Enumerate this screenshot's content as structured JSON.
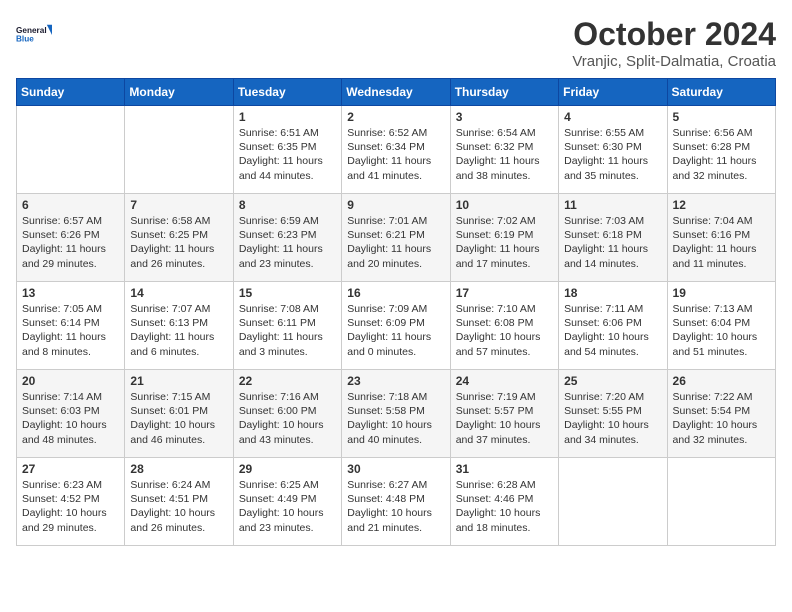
{
  "header": {
    "logo_line1": "General",
    "logo_line2": "Blue",
    "month": "October 2024",
    "location": "Vranjic, Split-Dalmatia, Croatia"
  },
  "days_of_week": [
    "Sunday",
    "Monday",
    "Tuesday",
    "Wednesday",
    "Thursday",
    "Friday",
    "Saturday"
  ],
  "weeks": [
    [
      {
        "day": "",
        "content": ""
      },
      {
        "day": "",
        "content": ""
      },
      {
        "day": "1",
        "content": "Sunrise: 6:51 AM\nSunset: 6:35 PM\nDaylight: 11 hours\nand 44 minutes."
      },
      {
        "day": "2",
        "content": "Sunrise: 6:52 AM\nSunset: 6:34 PM\nDaylight: 11 hours\nand 41 minutes."
      },
      {
        "day": "3",
        "content": "Sunrise: 6:54 AM\nSunset: 6:32 PM\nDaylight: 11 hours\nand 38 minutes."
      },
      {
        "day": "4",
        "content": "Sunrise: 6:55 AM\nSunset: 6:30 PM\nDaylight: 11 hours\nand 35 minutes."
      },
      {
        "day": "5",
        "content": "Sunrise: 6:56 AM\nSunset: 6:28 PM\nDaylight: 11 hours\nand 32 minutes."
      }
    ],
    [
      {
        "day": "6",
        "content": "Sunrise: 6:57 AM\nSunset: 6:26 PM\nDaylight: 11 hours\nand 29 minutes."
      },
      {
        "day": "7",
        "content": "Sunrise: 6:58 AM\nSunset: 6:25 PM\nDaylight: 11 hours\nand 26 minutes."
      },
      {
        "day": "8",
        "content": "Sunrise: 6:59 AM\nSunset: 6:23 PM\nDaylight: 11 hours\nand 23 minutes."
      },
      {
        "day": "9",
        "content": "Sunrise: 7:01 AM\nSunset: 6:21 PM\nDaylight: 11 hours\nand 20 minutes."
      },
      {
        "day": "10",
        "content": "Sunrise: 7:02 AM\nSunset: 6:19 PM\nDaylight: 11 hours\nand 17 minutes."
      },
      {
        "day": "11",
        "content": "Sunrise: 7:03 AM\nSunset: 6:18 PM\nDaylight: 11 hours\nand 14 minutes."
      },
      {
        "day": "12",
        "content": "Sunrise: 7:04 AM\nSunset: 6:16 PM\nDaylight: 11 hours\nand 11 minutes."
      }
    ],
    [
      {
        "day": "13",
        "content": "Sunrise: 7:05 AM\nSunset: 6:14 PM\nDaylight: 11 hours\nand 8 minutes."
      },
      {
        "day": "14",
        "content": "Sunrise: 7:07 AM\nSunset: 6:13 PM\nDaylight: 11 hours\nand 6 minutes."
      },
      {
        "day": "15",
        "content": "Sunrise: 7:08 AM\nSunset: 6:11 PM\nDaylight: 11 hours\nand 3 minutes."
      },
      {
        "day": "16",
        "content": "Sunrise: 7:09 AM\nSunset: 6:09 PM\nDaylight: 11 hours\nand 0 minutes."
      },
      {
        "day": "17",
        "content": "Sunrise: 7:10 AM\nSunset: 6:08 PM\nDaylight: 10 hours\nand 57 minutes."
      },
      {
        "day": "18",
        "content": "Sunrise: 7:11 AM\nSunset: 6:06 PM\nDaylight: 10 hours\nand 54 minutes."
      },
      {
        "day": "19",
        "content": "Sunrise: 7:13 AM\nSunset: 6:04 PM\nDaylight: 10 hours\nand 51 minutes."
      }
    ],
    [
      {
        "day": "20",
        "content": "Sunrise: 7:14 AM\nSunset: 6:03 PM\nDaylight: 10 hours\nand 48 minutes."
      },
      {
        "day": "21",
        "content": "Sunrise: 7:15 AM\nSunset: 6:01 PM\nDaylight: 10 hours\nand 46 minutes."
      },
      {
        "day": "22",
        "content": "Sunrise: 7:16 AM\nSunset: 6:00 PM\nDaylight: 10 hours\nand 43 minutes."
      },
      {
        "day": "23",
        "content": "Sunrise: 7:18 AM\nSunset: 5:58 PM\nDaylight: 10 hours\nand 40 minutes."
      },
      {
        "day": "24",
        "content": "Sunrise: 7:19 AM\nSunset: 5:57 PM\nDaylight: 10 hours\nand 37 minutes."
      },
      {
        "day": "25",
        "content": "Sunrise: 7:20 AM\nSunset: 5:55 PM\nDaylight: 10 hours\nand 34 minutes."
      },
      {
        "day": "26",
        "content": "Sunrise: 7:22 AM\nSunset: 5:54 PM\nDaylight: 10 hours\nand 32 minutes."
      }
    ],
    [
      {
        "day": "27",
        "content": "Sunrise: 6:23 AM\nSunset: 4:52 PM\nDaylight: 10 hours\nand 29 minutes."
      },
      {
        "day": "28",
        "content": "Sunrise: 6:24 AM\nSunset: 4:51 PM\nDaylight: 10 hours\nand 26 minutes."
      },
      {
        "day": "29",
        "content": "Sunrise: 6:25 AM\nSunset: 4:49 PM\nDaylight: 10 hours\nand 23 minutes."
      },
      {
        "day": "30",
        "content": "Sunrise: 6:27 AM\nSunset: 4:48 PM\nDaylight: 10 hours\nand 21 minutes."
      },
      {
        "day": "31",
        "content": "Sunrise: 6:28 AM\nSunset: 4:46 PM\nDaylight: 10 hours\nand 18 minutes."
      },
      {
        "day": "",
        "content": ""
      },
      {
        "day": "",
        "content": ""
      }
    ]
  ]
}
